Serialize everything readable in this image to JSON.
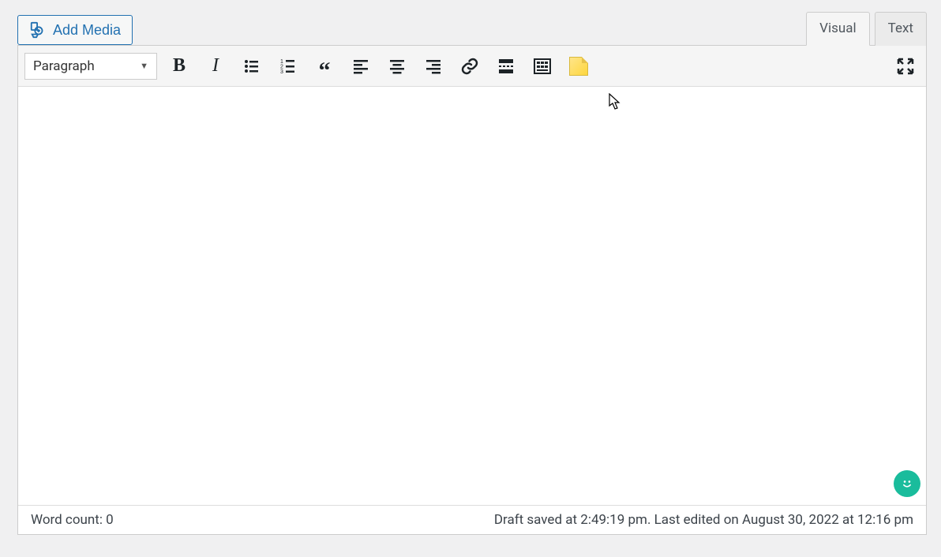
{
  "header": {
    "add_media_label": "Add Media"
  },
  "tabs": {
    "visual": "Visual",
    "text": "Text"
  },
  "toolbar": {
    "format_label": "Paragraph"
  },
  "status": {
    "word_count_label": "Word count: 0",
    "save_info": "Draft saved at 2:49:19 pm. Last edited on August 30, 2022 at 12:16 pm"
  }
}
